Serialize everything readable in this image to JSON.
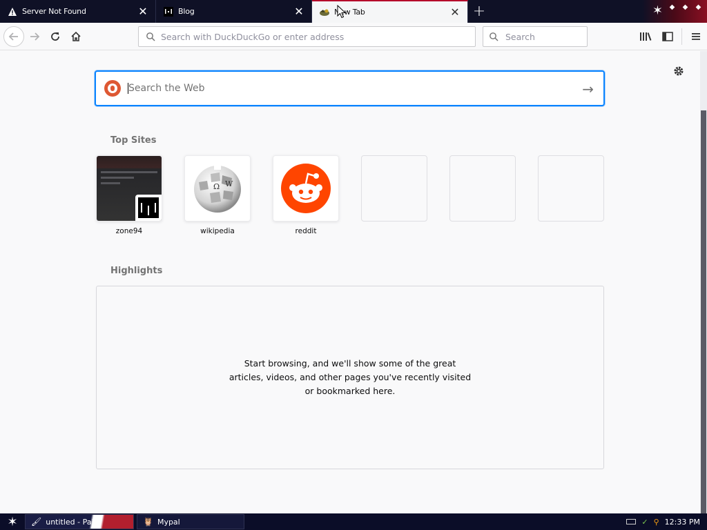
{
  "tabs": [
    {
      "label": "Server Not Found",
      "active": false,
      "favicon": "warning-icon"
    },
    {
      "label": "Blog",
      "active": false,
      "favicon": "blog-favicon"
    },
    {
      "label": "New Tab",
      "active": true,
      "favicon": "mypal-favicon"
    }
  ],
  "urlbar": {
    "placeholder": "Search with DuckDuckGo or enter address"
  },
  "searchbar": {
    "placeholder": "Search"
  },
  "newtab": {
    "search_placeholder": "Search the Web",
    "top_sites_title": "Top Sites",
    "top_sites": [
      {
        "name": "zone94"
      },
      {
        "name": "wikipedia"
      },
      {
        "name": "reddit"
      },
      {
        "name": ""
      },
      {
        "name": ""
      },
      {
        "name": ""
      }
    ],
    "highlights_title": "Highlights",
    "highlights_message": "Start browsing, and we'll show some of the great articles, videos, and other pages you've recently visited or bookmarked here."
  },
  "taskbar": {
    "items": [
      {
        "label": "untitled - Paint"
      },
      {
        "label": "Mypal"
      }
    ],
    "clock": "12:33 PM"
  },
  "colors": {
    "accent": "#0a84ff",
    "tab_active_border": "#b5052a",
    "reddit": "#ff4500",
    "ddg": "#de5833"
  }
}
